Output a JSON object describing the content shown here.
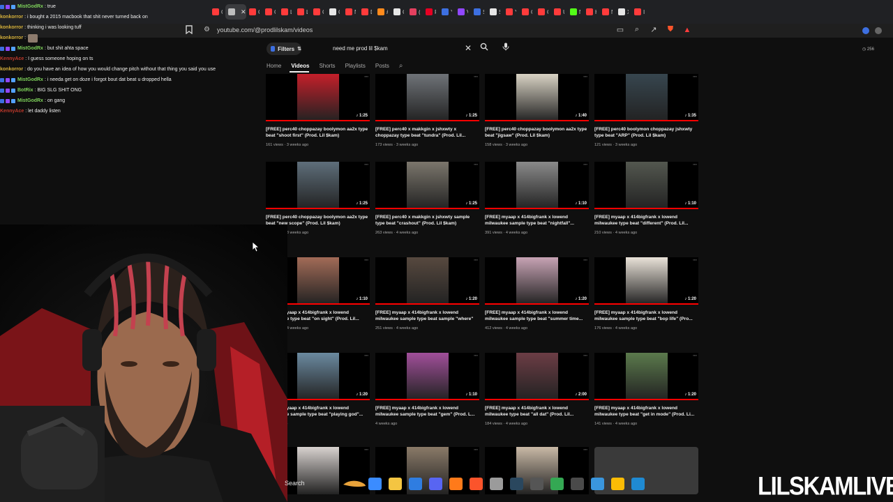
{
  "browser": {
    "tabs": [
      {
        "label": "C",
        "color": "#ff3b3b"
      },
      {
        "label": "P",
        "color": "#bdbdbd",
        "active": true
      },
      {
        "label": "C",
        "color": "#ff3b3b"
      },
      {
        "label": "C",
        "color": "#ff3b3b"
      },
      {
        "label": "Li",
        "color": "#ff3b3b"
      },
      {
        "label": "Li",
        "color": "#ff3b3b"
      },
      {
        "label": "C",
        "color": "#ff3b3b"
      },
      {
        "label": "C",
        "color": "#e6e6e6"
      },
      {
        "label": "N",
        "color": "#ff3b3b"
      },
      {
        "label": "D",
        "color": "#ff3b3b"
      },
      {
        "label": "#",
        "color": "#ff8a1c"
      },
      {
        "label": "G",
        "color": "#e6e6e6"
      },
      {
        "label": "(6",
        "color": "#e4405f"
      },
      {
        "label": "P",
        "color": "#e60023"
      },
      {
        "label": "Y",
        "color": "#3d6fe0"
      },
      {
        "label": "V",
        "color": "#9147ff"
      },
      {
        "label": "S",
        "color": "#3d6fe0"
      },
      {
        "label": "S",
        "color": "#e6e6e6"
      },
      {
        "label": "Y",
        "color": "#ff3b3b"
      },
      {
        "label": "C",
        "color": "#ff3b3b"
      },
      {
        "label": "C",
        "color": "#ff3b3b"
      },
      {
        "label": "U",
        "color": "#ff3b3b"
      },
      {
        "label": "N",
        "color": "#53fc18"
      },
      {
        "label": "H",
        "color": "#ff3b3b"
      },
      {
        "label": "N",
        "color": "#ff3b3b"
      },
      {
        "label": "X",
        "color": "#e6e6e6"
      },
      {
        "label": "In",
        "color": "#ff3b3b"
      }
    ],
    "url": "youtube.com/@prodlilskam/videos"
  },
  "youtube": {
    "filters_label": "Filters",
    "search_query": "need me prod lil $kam",
    "top_right_count": "256",
    "channel_tabs": [
      "Home",
      "Videos",
      "Shorts",
      "Playlists",
      "Posts"
    ],
    "active_tab": "Videos"
  },
  "videos": [
    {
      "title": "[FREE] perc40 choppazay boolymon aa2x type beat \"shoot first\" (Prod. Lil $kam)",
      "views": "161 views",
      "age": "3 weeks ago",
      "duration": "1:25",
      "thumb": "#c41f2a"
    },
    {
      "title": "[FREE] perc40 x makkgin x jshxwty x choppazay type beat \"tundra\" (Prod. Lil...",
      "views": "173 views",
      "age": "3 weeks ago",
      "duration": "1:25",
      "thumb": "#6f7378"
    },
    {
      "title": "[FREE] perc40 choppazay boolymon aa2x type beat \"jigsaw\" (Prod. Lil $kam)",
      "views": "158 views",
      "age": "3 weeks ago",
      "duration": "1:40",
      "thumb": "#d9d3c4"
    },
    {
      "title": "[FREE] perc40 boolymon choppazay jshxwty type beat \"ARP\" (Prod. Lil $kam)",
      "views": "121 views",
      "age": "3 weeks ago",
      "duration": "1:35",
      "thumb": "#37464f"
    },
    {
      "title": "[FREE] perc40 choppazay boolymon aa2x type beat \"new scope\" (Prod. Lil $kam)",
      "views": "148 views",
      "age": "3 weeks ago",
      "duration": "1:25",
      "thumb": "#5e6e7a"
    },
    {
      "title": "[FREE] perc40 x makkgin x jshxwty sample type beat \"crashout\" (Prod. Lil $kam)",
      "views": "263 views",
      "age": "4 weeks ago",
      "duration": "1:25",
      "thumb": "#7b766c"
    },
    {
      "title": "[FREE] myaap x 414bigfrank x lowend milwaukee sample type beat \"nightfall\"...",
      "views": "391 views",
      "age": "4 weeks ago",
      "duration": "1:10",
      "thumb": "#8a8a8a"
    },
    {
      "title": "[FREE] myaap x 414bigfrank x lowend milwaukee type beat \"different\" (Prod. Lil...",
      "views": "210 views",
      "age": "4 weeks ago",
      "duration": "1:10",
      "thumb": "#53574f"
    },
    {
      "title": "[FREE] myaap x 414bigfrank x lowend milwaukee type beat \"on sight\" (Prod. Lil...",
      "views": "209 views",
      "age": "4 weeks ago",
      "duration": "1:10",
      "thumb": "#a26b57"
    },
    {
      "title": "[FREE] myaap x 414bigfrank x lowend milwaukee sample type beat sample \"where\" (Prod...",
      "views": "251 views",
      "age": "4 weeks ago",
      "duration": "1:20",
      "thumb": "#57493f"
    },
    {
      "title": "[FREE] myaap x 414bigfrank x lowend milwaukee sample type beat \"summer time...",
      "views": "412 views",
      "age": "4 weeks ago",
      "duration": "1:20",
      "thumb": "#c7a3b4"
    },
    {
      "title": "[FREE] myaap x 414bigfrank x lowend milwaukee sample type beat \"bop life\" (Pro...",
      "views": "176 views",
      "age": "4 weeks ago",
      "duration": "1:20",
      "thumb": "#e9e2d8"
    },
    {
      "title": "[FREE] myaap x 414bigfrank x lowend milwaukee sample type beat \"playing god\"...",
      "views": "",
      "age": "4 weeks ago",
      "duration": "1:20",
      "thumb": "#6b8aa0"
    },
    {
      "title": "[FREE] myaap x 414bigfrank x lowend milwaukee sample type beat \"gem\" (Prod. L...",
      "views": "",
      "age": "4 weeks ago",
      "duration": "1:10",
      "thumb": "#a14f9a"
    },
    {
      "title": "[FREE] myaap x 414bigfrank x lowend milwaukee type beat \"all dat\" (Prod. Lil...",
      "views": "184 views",
      "age": "4 weeks ago",
      "duration": "2:00",
      "thumb": "#6c3d45"
    },
    {
      "title": "[FREE] myaap x 414bigfrank x lowend milwaukee type beat \"get in mode\" (Prod. Li...",
      "views": "141 views",
      "age": "4 weeks ago",
      "duration": "1:20",
      "thumb": "#5b7a4c"
    },
    {
      "title": "",
      "views": "",
      "age": "",
      "duration": "",
      "thumb": "#d8d2cf"
    },
    {
      "title": "",
      "views": "",
      "age": "",
      "duration": "",
      "thumb": "#8a7a68"
    },
    {
      "title": "",
      "views": "",
      "age": "",
      "duration": "",
      "thumb": "#c9b9a6"
    },
    {
      "title": "",
      "views": "",
      "age": "",
      "duration": "",
      "thumb": "#3a3a3a"
    }
  ],
  "chat": [
    {
      "user": "MistGodRx",
      "text": ": true",
      "color": "#7fd45b",
      "badges": true
    },
    {
      "user": "konkorror",
      "text": ": i bought a 2015 macbook that shit never turned back on",
      "color": "#d6b13b",
      "badges": false
    },
    {
      "user": "konkorror",
      "text": ": thinking i was looking tuff",
      "color": "#d6b13b",
      "badges": false
    },
    {
      "user": "konkorror",
      "text": ":",
      "color": "#d6b13b",
      "badges": false,
      "emote": true
    },
    {
      "user": "MistGodRx",
      "text": ": but shit ahta space",
      "color": "#7fd45b",
      "badges": true
    },
    {
      "user": "KennyAce",
      "text": ": I guess someone hoping on ts",
      "color": "#c0392b",
      "badges": false
    },
    {
      "user": "konkorror",
      "text": ": do you have an idea of how you would change pitch without that thing you said you use",
      "color": "#d6b13b",
      "badges": false
    },
    {
      "user": "MistGodRx",
      "text": ": i needa get on doze i forgot bout dat beat u dropped hella",
      "color": "#7fd45b",
      "badges": true
    },
    {
      "user": "BotRix",
      "text": ": BIG SLG SHIT ONG",
      "color": "#7fd45b",
      "badges": true
    },
    {
      "user": "MistGodRx",
      "text": ": on gang",
      "color": "#7fd45b",
      "badges": true
    },
    {
      "user": "KennyAce",
      "text": ": let daddy listen",
      "color": "#c0392b",
      "badges": false
    }
  ],
  "taskbar": {
    "search_label": "Search",
    "apps": [
      {
        "name": "copilot-icon",
        "color": "#3b8cff"
      },
      {
        "name": "file-explorer-icon",
        "color": "#f4c542"
      },
      {
        "name": "calendar-icon",
        "color": "#2f7de1"
      },
      {
        "name": "discord-icon",
        "color": "#5865f2"
      },
      {
        "name": "unknown-app-icon",
        "color": "#ff7a1a"
      },
      {
        "name": "brave-icon",
        "color": "#fb542b"
      },
      {
        "name": "settings-icon",
        "color": "#9b9b9b"
      },
      {
        "name": "steam-icon",
        "color": "#2a475e"
      },
      {
        "name": "keyboard-icon",
        "color": "#555555"
      },
      {
        "name": "chrome-icon",
        "color": "#34a853"
      },
      {
        "name": "4k-app-icon",
        "color": "#4a4a4a"
      },
      {
        "name": "notepad-icon",
        "color": "#3a96dd"
      },
      {
        "name": "chrome-alt-icon",
        "color": "#fbbc05"
      },
      {
        "name": "photos-icon",
        "color": "#1f8ad2"
      }
    ]
  },
  "branding": {
    "text": "LILSKAMLIVE"
  }
}
